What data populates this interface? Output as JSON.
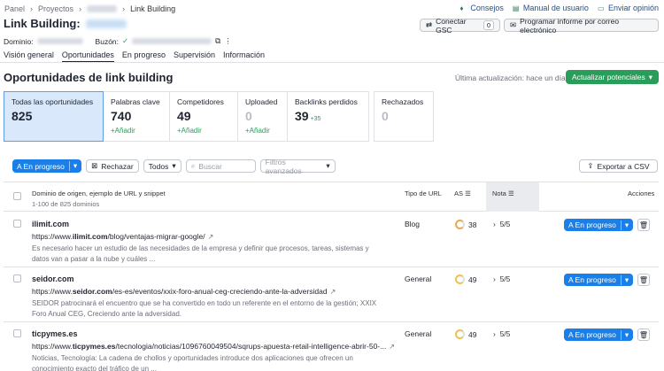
{
  "breadcrumb": {
    "items": [
      "Panel",
      "Proyectos",
      "Link Building"
    ]
  },
  "toplinks": {
    "tips": "Consejos",
    "manual": "Manual de usuario",
    "feedback": "Enviar opinión"
  },
  "header": {
    "title": "Link Building:",
    "gsc_label": "Conectar GSC",
    "gsc_count": "0",
    "mail_label": "Programar informe por correo electrónico"
  },
  "domain_line": {
    "domain_label": "Dominio:",
    "mailbox_label": "Buzón:"
  },
  "tabs": [
    {
      "label": "Visión general"
    },
    {
      "label": "Oportunidades"
    },
    {
      "label": "En progreso"
    },
    {
      "label": "Supervisión"
    },
    {
      "label": "Información"
    }
  ],
  "main": {
    "heading": "Oportunidades de link building",
    "last_update": "Última actualización: hace un día",
    "update_button": "Actualizar potenciales"
  },
  "cards": [
    {
      "label": "Todas las oportunidades",
      "value": "825",
      "add": "",
      "delta": ""
    },
    {
      "label": "Palabras clave",
      "value": "740",
      "add": "+Añadir",
      "delta": ""
    },
    {
      "label": "Competidores",
      "value": "49",
      "add": "+Añadir",
      "delta": ""
    },
    {
      "label": "Uploaded",
      "value": "0",
      "add": "+Añadir",
      "delta": ""
    },
    {
      "label": "Backlinks perdidos",
      "value": "39",
      "add": "",
      "delta": "+35"
    },
    {
      "label": "Rechazados",
      "value": "0",
      "add": "",
      "delta": ""
    }
  ],
  "toolbar": {
    "in_progress": "A En progreso",
    "reject": "Rechazar",
    "filter_all": "Todos",
    "search_placeholder": "Buscar",
    "advanced": "Filtros avanzados",
    "export": "Exportar a CSV"
  },
  "table": {
    "col_source": "Dominio de origen, ejemplo de URL y snippet",
    "col_range": "1-100 de 825 dominios",
    "col_type": "Tipo de URL",
    "col_as": "AS",
    "col_score": "Nota",
    "col_actions": "Acciones",
    "rows": [
      {
        "domain": "ilimit.com",
        "url_prefix": "https://www.",
        "url_bold": "ilimit.com",
        "url_rest": "/blog/ventajas-migrar-google/",
        "snippet": "Es necesario hacer un estudio de las necesidades de la empresa y definir que procesos, tareas, sistemas y datos van a pasar a la nube y cuáles ...",
        "type": "Blog",
        "as": "38",
        "score": "5/5",
        "action": "A En progreso"
      },
      {
        "domain": "seidor.com",
        "url_prefix": "https://www.",
        "url_bold": "seidor.com",
        "url_rest": "/es-es/eventos/xxix-foro-anual-ceg-creciendo-ante-la-adversidad",
        "snippet": "SEIDOR patrocinará el encuentro que se ha convertido en todo un referente en el entorno de la gestión; XXIX Foro Anual CEG, Creciendo ante la adversidad.",
        "type": "General",
        "as": "49",
        "score": "5/5",
        "action": "A En progreso"
      },
      {
        "domain": "ticpymes.es",
        "url_prefix": "https://www.",
        "url_bold": "ticpymes.es",
        "url_rest": "/tecnologia/noticias/1096760049504/sqrups-apuesta-retail-intelligence-abrir-50-...",
        "snippet": "Noticias, Tecnología: La cadena de chollos y oportunidades introduce dos aplicaciones que ofrecen un conocimiento exacto del tráfico de un ...",
        "type": "General",
        "as": "49",
        "score": "5/5",
        "action": "A En progreso"
      }
    ]
  }
}
